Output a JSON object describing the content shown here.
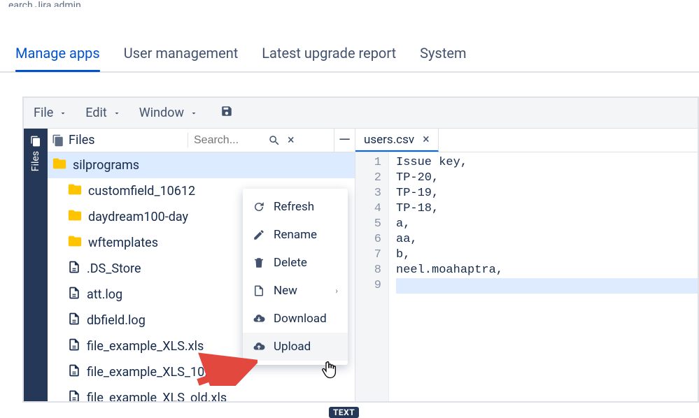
{
  "top_fragment": "earch Jira admin",
  "nav": {
    "tabs": [
      "Manage apps",
      "User management",
      "Latest upgrade report",
      "System"
    ],
    "active_index": 0
  },
  "toolbar": {
    "file": "File",
    "edit": "Edit",
    "window": "Window"
  },
  "side_rail": {
    "label": "Files"
  },
  "files_panel": {
    "title": "Files",
    "search_placeholder": "Search..."
  },
  "tree": {
    "root": "silprograms",
    "folders": [
      "customfield_10612",
      "daydream100-day",
      "wftemplates"
    ],
    "files": [
      ".DS_Store",
      "att.log",
      "dbfield.log",
      "file_example_XLS.xls",
      "file_example_XLS_10.xls",
      "file_example_XLS_old.xls"
    ]
  },
  "file_badge": "TEXT",
  "context_menu": {
    "refresh": "Refresh",
    "rename": "Rename",
    "delete": "Delete",
    "new": "New",
    "download": "Download",
    "upload": "Upload"
  },
  "editor": {
    "tab_name": "users.csv",
    "lines": [
      "Issue key,",
      "TP-20,",
      "TP-19,",
      "TP-18,",
      "a,",
      "aa,",
      "b,",
      "neel.moahaptra,",
      ""
    ]
  }
}
